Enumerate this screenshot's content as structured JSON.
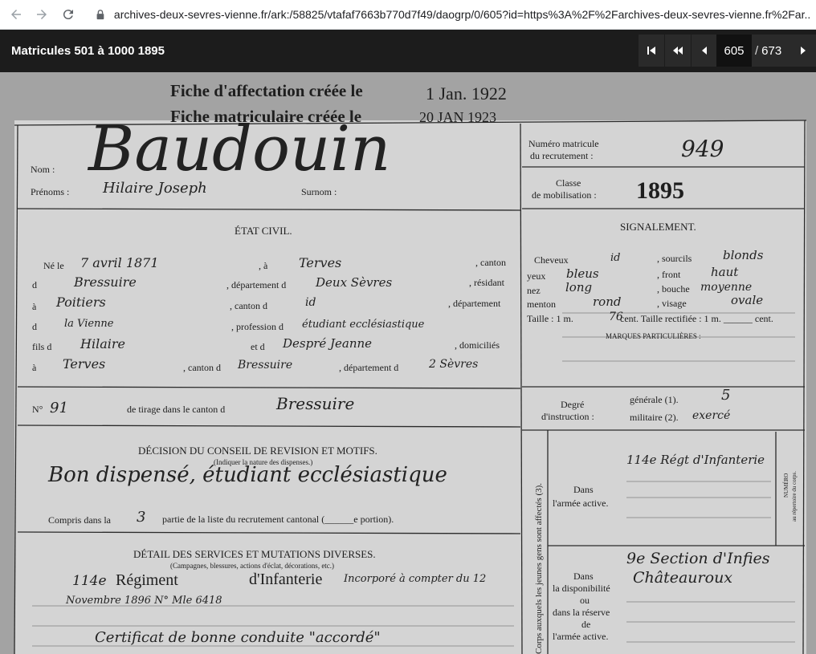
{
  "browser": {
    "url": "archives-deux-sevres-vienne.fr/ark:/58825/vtafaf7663b770d7f49/daogrp/0/605?id=https%3A%2F%2Farchives-deux-sevres-vienne.fr%2Far..."
  },
  "viewer": {
    "title": "Matricules 501 à 1000 1895",
    "current_page": "605",
    "page_sep": "/",
    "total_pages": "673"
  },
  "document": {
    "stamp_line1": "Fiche d'affectation créée le",
    "stamp_date1": "1 Jan. 1922",
    "stamp_line2": "Fiche matriculaire créée le",
    "stamp_date2": "20 JAN 1923",
    "surname_hand": "Baudouin",
    "nom_label": "Nom :",
    "prenoms_label": "Prénoms :",
    "prenoms_hand": "Hilaire Joseph",
    "surnom_label": "Surnom :",
    "numero_label1": "Numéro matricule",
    "numero_label2": "du recrutement :",
    "numero_hand": "949",
    "classe_label1": "Classe",
    "classe_label2": "de mobilisation :",
    "classe_value": "1895",
    "etat_civil_title": "ÉTAT CIVIL.",
    "signalement_title": "SIGNALEMENT.",
    "ne_le": "Né le",
    "ne_le_hand": "7 avril 1871",
    "a_label": ", à",
    "a_hand": "Terves",
    "canton_label": ", canton",
    "d_label": "d",
    "canton_hand": "Bressuire",
    "dept_label": ", département d",
    "dept_hand": "Deux Sèvres",
    "resident_label": ", résidant",
    "a2_label": "à",
    "res_hand": "Poitiers",
    "canton2_label": ", canton d",
    "canton2_hand": "id",
    "dept2_label": ", département",
    "des_label": "d",
    "dept2_hand": "la Vienne",
    "profession_label": ", profession d",
    "profession_hand": "étudiant ecclésiastique",
    "fils_label": "fils d",
    "fils_hand": "Hilaire",
    "et_label": "et d",
    "mere_hand": "Despré Jeanne",
    "domicilies_label": ", domiciliés",
    "a3_label": "à",
    "dom_hand": "Terves",
    "canton3_label": ", canton d",
    "canton3_hand": "Bressuire",
    "dept3_label": ", département d",
    "dept3_hand": "2 Sèvres",
    "tirage_no": "N°",
    "tirage_hand": "91",
    "tirage_label": "de tirage dans le canton d",
    "tirage_canton_hand": "Bressuire",
    "decision_title": "DÉCISION DU CONSEIL DE REVISION ET MOTIFS.",
    "decision_sub": "(Indiquer la nature des dispenses.)",
    "decision_hand": "Bon  dispensé, étudiant ecclésiastique",
    "compris_label": "Compris dans la",
    "compris_hand": "3",
    "compris_rest": "partie de la liste du recrutement cantonal (______e portion).",
    "detail_title": "DÉTAIL DES SERVICES ET MUTATIONS DIVERSES.",
    "detail_sub": "(Campagnes, blessures, actions d'éclat, décorations, etc.)",
    "regiment_hand_prefix": "114e",
    "regiment_printed": "Régiment",
    "infanterie_printed": "d'Infanterie",
    "regiment_hand_rest": "Incorporé à compter du 12",
    "novembre_hand": "Novembre 1896 N° Mle 6418",
    "certificat_hand": "Certificat de bonne conduite \"accordé\"",
    "cheveux_label": "Cheveux",
    "cheveux_hand": "id",
    "sourcils_label": ", sourcils",
    "sourcils_hand": "blonds",
    "yeux_label": "yeux",
    "yeux_hand": "bleus",
    "front_label": ", front",
    "front_hand": "haut",
    "nez_label": "nez",
    "nez_hand": "long",
    "bouche_label": ", bouche",
    "bouche_hand": "moyenne",
    "menton_label": "menton",
    "menton_hand": "rond",
    "visage_label": ", visage",
    "visage_hand": "ovale",
    "taille_label": "Taille : 1 m.",
    "taille_hand": "76",
    "taille_rest": "cent. Taille rectifiée : 1 m. ______ cent.",
    "marques_label": "MARQUES PARTICULIÈRES :",
    "degre_label1": "Degré",
    "degre_label2": "d'instruction :",
    "generale_label": "générale (1).",
    "generale_hand": "5",
    "militaire_label": "militaire (2).",
    "militaire_hand": "exercé",
    "side_vertical": "Corps auxquels les jeunes gens sont affectés (3).",
    "active_label1": "Dans",
    "active_label2": "l'armée active.",
    "active_hand": "114e Régt d'Infanterie",
    "numero_vertical1": "NUMÉRO",
    "numero_vertical2": "au répertoire du corps.",
    "dispo_label1": "Dans",
    "dispo_label2": "la disponibilité",
    "dispo_label3": "ou",
    "dispo_label4": "dans la réserve",
    "dispo_label5": "de",
    "dispo_label6": "l'armée active.",
    "dispo_hand1": "9e Section d'Infies",
    "dispo_hand2": "Châteauroux"
  }
}
